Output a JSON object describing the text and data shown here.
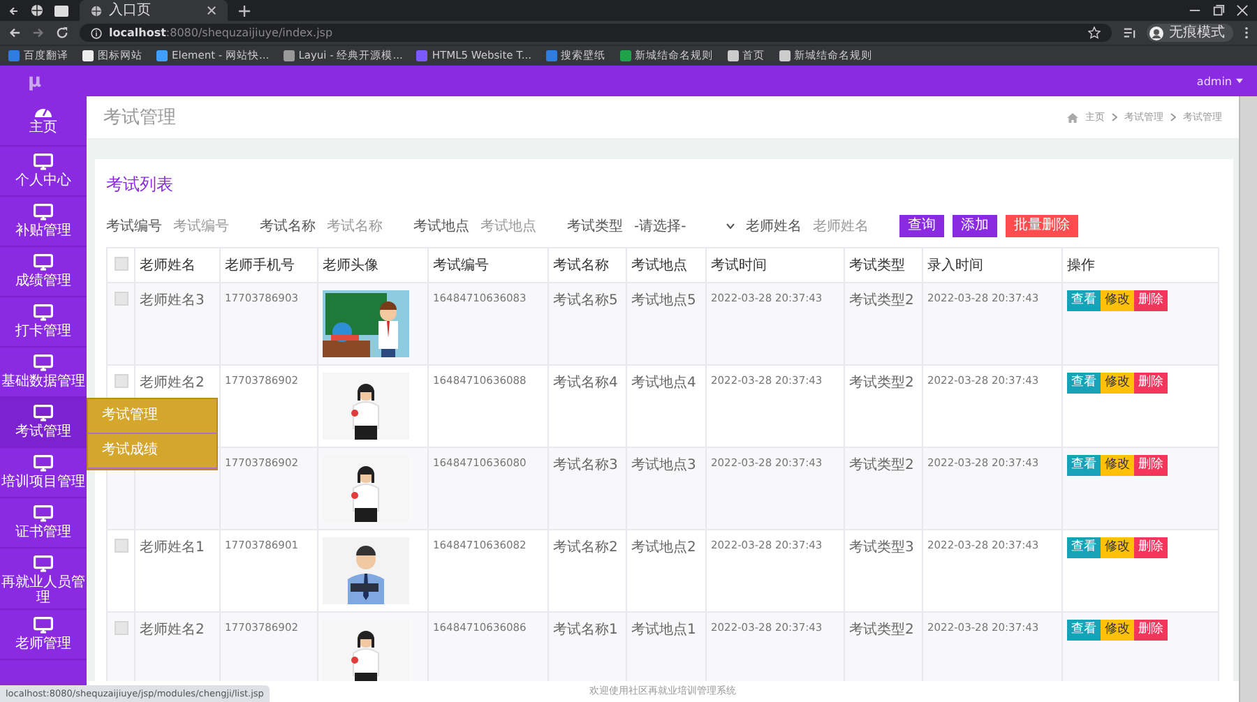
{
  "browser": {
    "tab_title": "入口页",
    "url_host": "localhost",
    "url_path": ":8080/shequzaijiuye/index.jsp",
    "profile": "无痕模式",
    "status_url": "localhost:8080/shequzaijiuye/jsp/modules/chengji/list.jsp",
    "bookmarks": [
      "百度翻译",
      "图标网站",
      "Element - 网站快...",
      "Layui - 经典开源模...",
      "HTML5 Website T...",
      "搜索壁纸",
      "新城结命名规则",
      "首页",
      "新城结命名规则"
    ]
  },
  "header": {
    "logo": "μ",
    "user": "admin"
  },
  "sidebar": {
    "items": [
      {
        "label": "主页",
        "kind": "home"
      },
      {
        "label": "个人中心",
        "kind": "module"
      },
      {
        "label": "补贴管理",
        "kind": "module"
      },
      {
        "label": "成绩管理",
        "kind": "module"
      },
      {
        "label": "打卡管理",
        "kind": "module"
      },
      {
        "label": "基础数据管理",
        "kind": "module"
      },
      {
        "label": "考试管理",
        "kind": "module",
        "expanded": true,
        "children": [
          {
            "label": "考试管理"
          },
          {
            "label": "考试成绩"
          }
        ]
      },
      {
        "label": "培训项目管理",
        "kind": "module"
      },
      {
        "label": "证书管理",
        "kind": "module"
      },
      {
        "label": "再就业人员管理",
        "kind": "module"
      },
      {
        "label": "老师管理",
        "kind": "module"
      }
    ]
  },
  "page": {
    "title": "考试管理",
    "breadcrumb": [
      "主页",
      "考试管理",
      "考试管理"
    ]
  },
  "card": {
    "title": "考试列表",
    "filters": [
      {
        "kind": "text",
        "label": "考试编号",
        "placeholder": "考试编号"
      },
      {
        "kind": "text",
        "label": "考试名称",
        "placeholder": "考试名称"
      },
      {
        "kind": "text",
        "label": "考试地点",
        "placeholder": "考试地点"
      },
      {
        "kind": "select",
        "label": "考试类型",
        "value": "-请选择-"
      },
      {
        "kind": "text",
        "label": "老师姓名",
        "placeholder": "老师姓名"
      }
    ],
    "buttons": [
      {
        "label": "查询",
        "kind": "primary"
      },
      {
        "label": "添加",
        "kind": "primary"
      },
      {
        "label": "批量删除",
        "kind": "danger"
      }
    ]
  },
  "table": {
    "header_checked": false,
    "columns": [
      "老师姓名",
      "老师手机号",
      "老师头像",
      "考试编号",
      "考试名称",
      "考试地点",
      "考试时间",
      "考试类型",
      "录入时间",
      "操作"
    ],
    "rows": [
      {
        "checked": false,
        "teacher_name": "老师姓名3",
        "phone": "17703786903",
        "exam_no": "16484710636083",
        "exam_name": "考试名称5",
        "exam_place": "考试地点5",
        "exam_time": "2022-03-28 20:37:43",
        "exam_type": "考试类型2",
        "created": "2022-03-28 20:37:43",
        "actions": [
          "查看",
          "修改",
          "删除"
        ]
      },
      {
        "checked": false,
        "teacher_name": "老师姓名2",
        "phone": "17703786902",
        "exam_no": "16484710636088",
        "exam_name": "考试名称4",
        "exam_place": "考试地点4",
        "exam_time": "2022-03-28 20:37:43",
        "exam_type": "考试类型2",
        "created": "2022-03-28 20:37:43",
        "actions": [
          "查看",
          "修改",
          "删除"
        ]
      },
      {
        "phone": "17703786902",
        "exam_no": "16484710636080",
        "exam_name": "考试名称3",
        "exam_place": "考试地点3",
        "exam_time": "2022-03-28 20:37:43",
        "exam_type": "考试类型2",
        "created": "2022-03-28 20:37:43",
        "actions": [
          "查看",
          "修改",
          "删除"
        ]
      },
      {
        "checked": false,
        "teacher_name": "老师姓名1",
        "phone": "17703786901",
        "exam_no": "16484710636082",
        "exam_name": "考试名称2",
        "exam_place": "考试地点2",
        "exam_time": "2022-03-28 20:37:43",
        "exam_type": "考试类型3",
        "created": "2022-03-28 20:37:43",
        "actions": [
          "查看",
          "修改",
          "删除"
        ]
      },
      {
        "checked": false,
        "teacher_name": "老师姓名2",
        "phone": "17703786902",
        "exam_no": "16484710636086",
        "exam_name": "考试名称1",
        "exam_place": "考试地点1",
        "exam_time": "2022-03-28 20:37:43",
        "exam_type": "考试类型2",
        "created": "2022-03-28 20:37:43",
        "actions": [
          "查看",
          "修改",
          "删除"
        ]
      }
    ]
  },
  "footer": "欢迎使用社区再就业培训管理系统"
}
